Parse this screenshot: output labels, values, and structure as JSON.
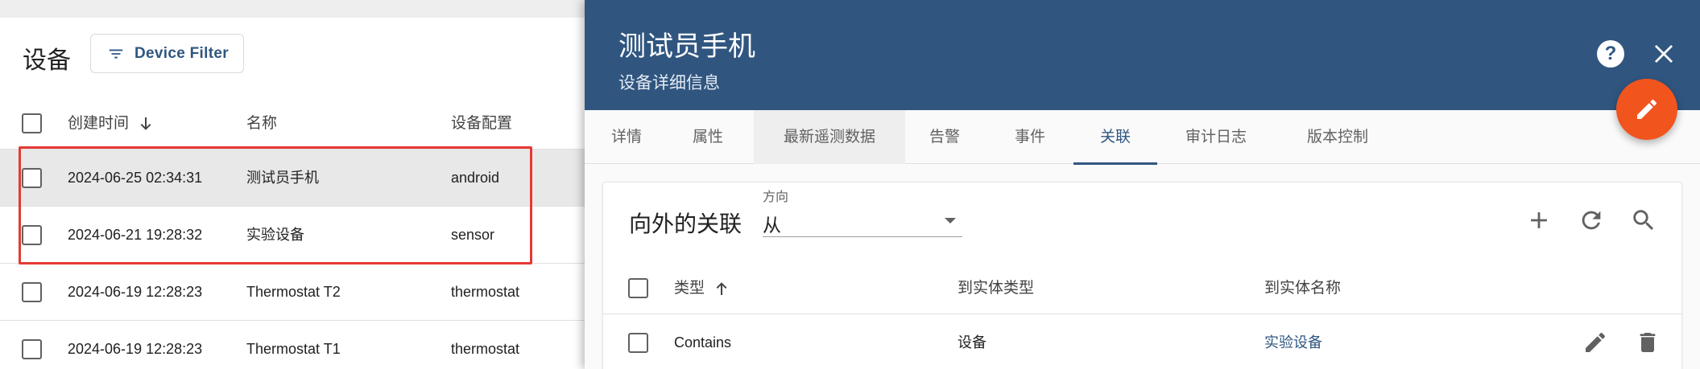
{
  "device_list": {
    "title": "设备",
    "filter_button_label": "Device Filter",
    "columns": [
      "创建时间",
      "名称",
      "设备配置"
    ],
    "rows": [
      {
        "created": "2024-06-25 02:34:31",
        "name": "测试员手机",
        "profile": "android"
      },
      {
        "created": "2024-06-21 19:28:32",
        "name": "实验设备",
        "profile": "sensor"
      },
      {
        "created": "2024-06-19 12:28:23",
        "name": "Thermostat T2",
        "profile": "thermostat"
      },
      {
        "created": "2024-06-19 12:28:23",
        "name": "Thermostat T1",
        "profile": "thermostat"
      }
    ]
  },
  "detail": {
    "title": "测试员手机",
    "subtitle": "设备详细信息",
    "help_icon_glyph": "?",
    "tabs": [
      "详情",
      "属性",
      "最新遥测数据",
      "告警",
      "事件",
      "关联",
      "审计日志",
      "版本控制"
    ],
    "active_tab": "关联",
    "relations": {
      "title": "向外的关联",
      "direction_label": "方向",
      "direction_value": "从",
      "columns": [
        "类型",
        "到实体类型",
        "到实体名称"
      ],
      "rows": [
        {
          "type": "Contains",
          "entity_type": "设备",
          "entity_name": "实验设备"
        }
      ]
    }
  },
  "colors": {
    "header_bg": "#305680",
    "fab_bg": "#f2541e",
    "highlight_border": "#e53935",
    "link": "#305680"
  },
  "icons": [
    "filter-icon",
    "arrow-down-icon",
    "help-icon",
    "close-icon",
    "edit-icon",
    "add-icon",
    "refresh-icon",
    "search-icon",
    "arrow-up-icon",
    "delete-icon"
  ]
}
